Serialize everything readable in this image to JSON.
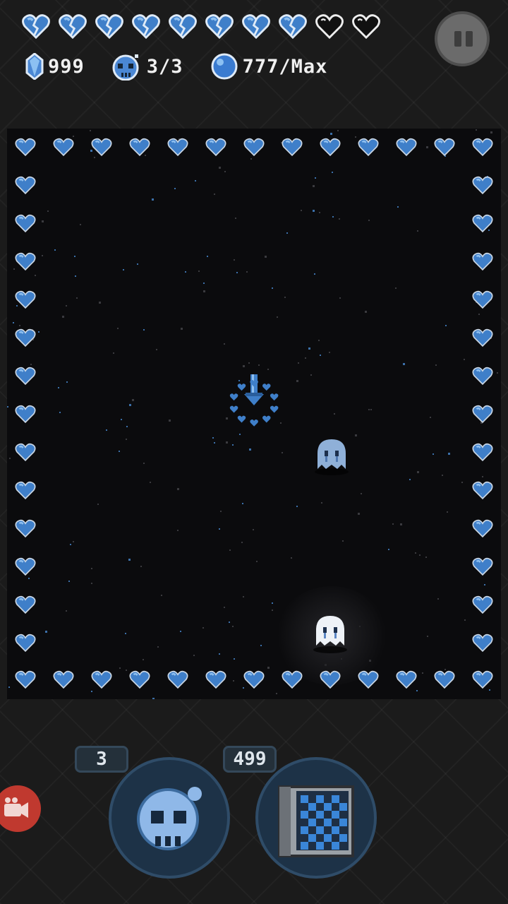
{
  "hud": {
    "hearts": [
      "blue-broken",
      "blue-broken",
      "blue-broken",
      "blue-broken",
      "blue-broken",
      "blue-broken",
      "blue-broken",
      "blue-broken",
      "empty",
      "empty"
    ],
    "crystals": "999",
    "skull_count": "3/3",
    "orbs": "777/Max"
  },
  "pause_button": {
    "icon": "pause-icon"
  },
  "arena": {
    "border_icon": "blue-heart-icon",
    "player_icon": "heart-ring-sword-icon",
    "enemies": [
      "blue-ghost-icon",
      "white-ghost-icon"
    ]
  },
  "abilities": {
    "skull": {
      "count": "3",
      "icon": "skull-bomb-icon"
    },
    "scroll": {
      "count": "499",
      "icon": "map-scroll-icon"
    }
  },
  "record_button": {
    "icon": "camera-record-icon"
  },
  "colors": {
    "heart_blue": "#3f7fc9",
    "heart_light": "#8fc0f0",
    "ghost_blue": "#8fb0d8",
    "ability_bg": "#1d3247",
    "record_red": "#c0392f"
  }
}
